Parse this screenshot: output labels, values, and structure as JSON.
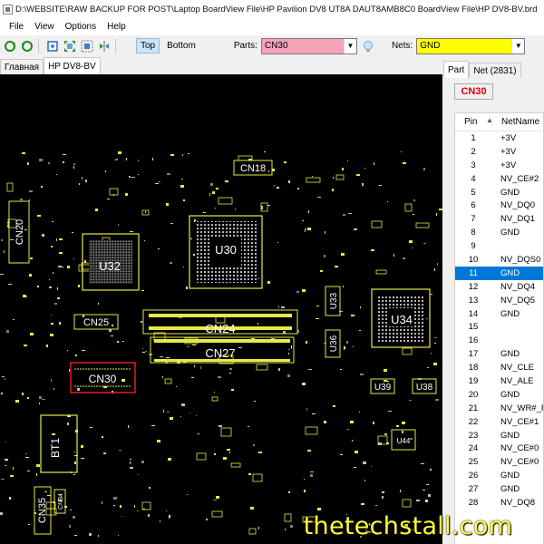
{
  "window": {
    "title": "D:\\WEBSITE\\RAW BACKUP FOR POST\\Laptop BoardView File\\HP Pavilion DV8 UT8A DAUT8AMB8C0 BoardView File\\HP DV8-BV.brd"
  },
  "menu": [
    "File",
    "View",
    "Options",
    "Help"
  ],
  "toolbar": {
    "top_label": "Top",
    "bottom_label": "Bottom",
    "parts_label": "Parts:",
    "parts_value": "CN30",
    "nets_label": "Nets:",
    "nets_value": "GND",
    "colors": {
      "parts_bg": "#f5a3b8",
      "nets_bg": "#ffff00"
    }
  },
  "tabs": [
    {
      "label": "Главная",
      "active": false
    },
    {
      "label": "HP DV8-BV",
      "active": true
    }
  ],
  "board": {
    "background": "#000000",
    "accent": "#e8e84a",
    "components": [
      {
        "ref": "CN18"
      },
      {
        "ref": "CN20"
      },
      {
        "ref": "U32"
      },
      {
        "ref": "U30"
      },
      {
        "ref": "U33"
      },
      {
        "ref": "U34"
      },
      {
        "ref": "CN25"
      },
      {
        "ref": "CN24"
      },
      {
        "ref": "U36"
      },
      {
        "ref": "CN27"
      },
      {
        "ref": "CN30",
        "selected": true
      },
      {
        "ref": "U39"
      },
      {
        "ref": "U38"
      },
      {
        "ref": "U44"
      },
      {
        "ref": "BT1"
      },
      {
        "ref": "CN35"
      },
      {
        "ref": "CN34"
      }
    ]
  },
  "right_panel": {
    "tabs": [
      {
        "label": "Part",
        "active": true
      },
      {
        "label": "Net (2831)",
        "active": false
      }
    ],
    "part_name": "CN30",
    "columns": {
      "pin": "Pin",
      "net": "NetName"
    },
    "pins": [
      {
        "pin": "1",
        "net": "+3V"
      },
      {
        "pin": "2",
        "net": "+3V"
      },
      {
        "pin": "3",
        "net": "+3V"
      },
      {
        "pin": "4",
        "net": "NV_CE#2"
      },
      {
        "pin": "5",
        "net": "GND"
      },
      {
        "pin": "6",
        "net": "NV_DQ0"
      },
      {
        "pin": "7",
        "net": "NV_DQ1"
      },
      {
        "pin": "8",
        "net": "GND"
      },
      {
        "pin": "9",
        "net": ""
      },
      {
        "pin": "10",
        "net": "NV_DQS0"
      },
      {
        "pin": "11",
        "net": "GND",
        "selected": true
      },
      {
        "pin": "12",
        "net": "NV_DQ4"
      },
      {
        "pin": "13",
        "net": "NV_DQ5"
      },
      {
        "pin": "14",
        "net": "GND"
      },
      {
        "pin": "15",
        "net": ""
      },
      {
        "pin": "16",
        "net": ""
      },
      {
        "pin": "17",
        "net": "GND"
      },
      {
        "pin": "18",
        "net": "NV_CLE"
      },
      {
        "pin": "19",
        "net": "NV_ALE"
      },
      {
        "pin": "20",
        "net": "GND"
      },
      {
        "pin": "21",
        "net": "NV_WR#_R"
      },
      {
        "pin": "22",
        "net": "NV_CE#1"
      },
      {
        "pin": "23",
        "net": "GND"
      },
      {
        "pin": "24",
        "net": "NV_CE#0"
      },
      {
        "pin": "25",
        "net": "NV_CE#0"
      },
      {
        "pin": "26",
        "net": "GND"
      },
      {
        "pin": "27",
        "net": "GND"
      },
      {
        "pin": "28",
        "net": "NV_DQ8"
      }
    ]
  },
  "watermark": "thetechstall.com",
  "icons": [
    "app-icon",
    "refresh-icon",
    "rotate-icon",
    "zoom-icon",
    "fit-icon",
    "zoom-area-icon",
    "mirror-icon",
    "search-icon"
  ]
}
